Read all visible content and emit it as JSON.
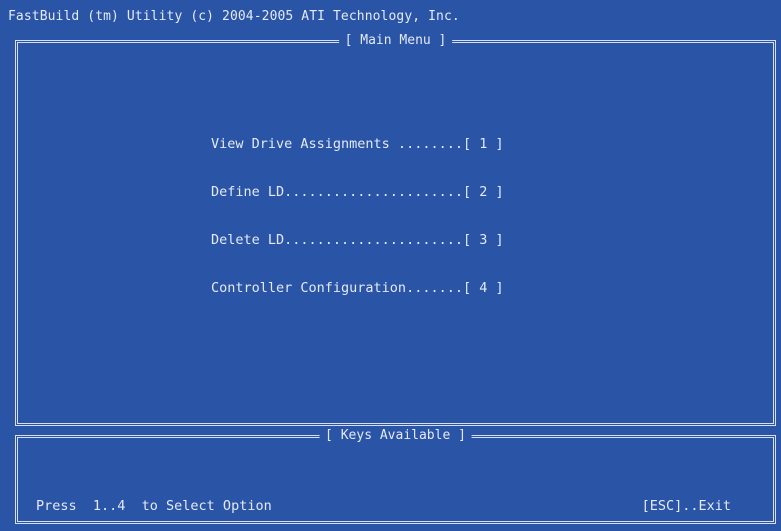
{
  "header": {
    "title": "FastBuild (tm) Utility (c) 2004-2005 ATI Technology, Inc."
  },
  "main_menu": {
    "title": "[ Main Menu ]",
    "items": [
      {
        "label": "View Drive Assignments ........[ 1 ]"
      },
      {
        "label": "Define LD......................[ 2 ]"
      },
      {
        "label": "Delete LD......................[ 3 ]"
      },
      {
        "label": "Controller Configuration.......[ 4 ]"
      }
    ]
  },
  "keys_panel": {
    "title": "[ Keys Available ]",
    "hint": "Press  1..4  to Select Option",
    "exit": "[ESC]..Exit"
  },
  "colors": {
    "background": "#2a55a6",
    "text": "#e4e9f5",
    "border": "#d6def0"
  }
}
